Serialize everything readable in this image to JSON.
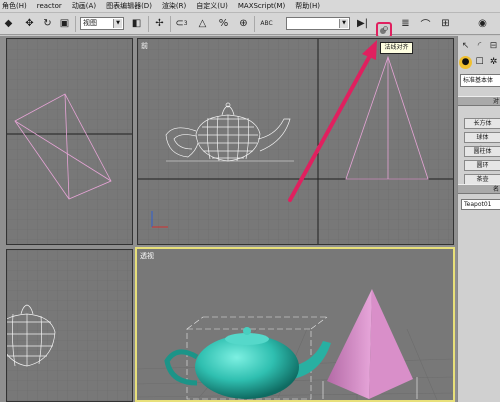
{
  "menubar": {
    "items": [
      "角色(H)",
      "reactor",
      "动画(A)",
      "图表编辑器(D)",
      "渲染(R)",
      "自定义(U)",
      "MAXScript(M)",
      "帮助(H)"
    ]
  },
  "toolbar": {
    "view_select": "视图",
    "tooltip": "法线对齐",
    "abc_label": "ABC",
    "spinner_mark": "3"
  },
  "viewports": {
    "front_label": "前",
    "persp_label": "透视"
  },
  "command_panel": {
    "dropdown": "标准基本体",
    "object_type_header": "对",
    "auto_grid": "自",
    "primitives": [
      "长方体",
      "球体",
      "圆柱体",
      "圆环",
      "茶壶"
    ],
    "name_header": "名",
    "object_name": "Teapot01"
  },
  "colors": {
    "highlight": "#e0205f",
    "grid_bg": "#787878",
    "active_border": "#e8e07a",
    "teapot": "#2fbfb0",
    "pyramid": "#d98fc9"
  }
}
